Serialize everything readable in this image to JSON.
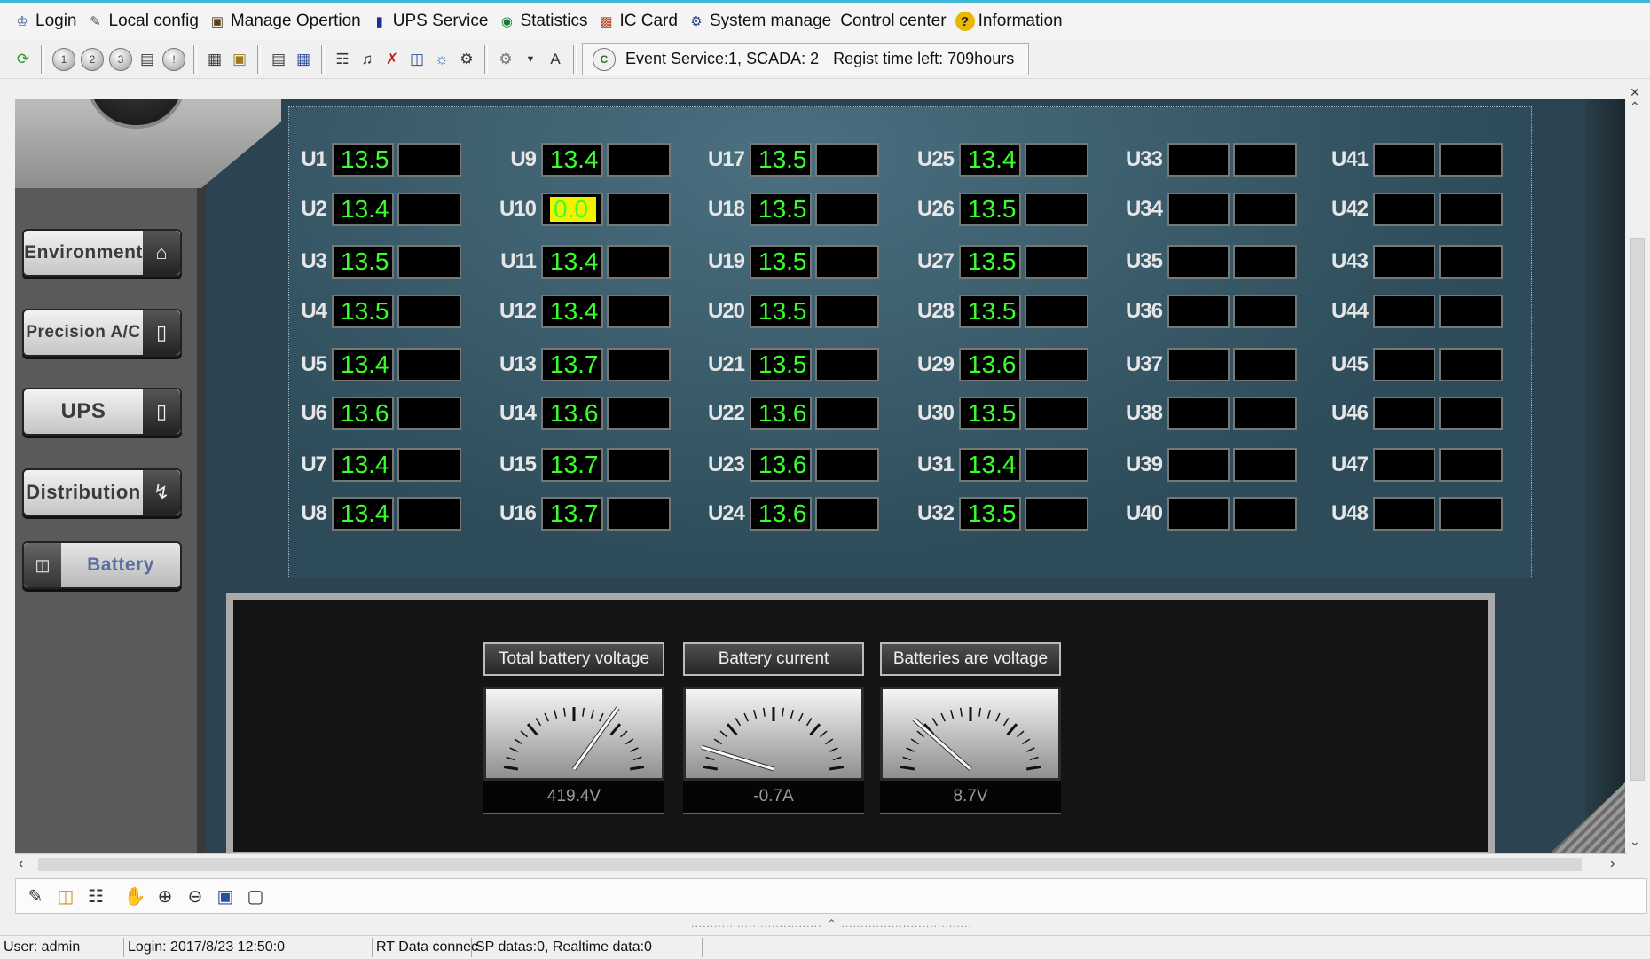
{
  "menu": [
    {
      "label": "Login",
      "icon": "login-icon"
    },
    {
      "label": "Local config",
      "icon": "local-config-icon"
    },
    {
      "label": "Manage Opertion",
      "icon": "manage-operation-icon"
    },
    {
      "label": "UPS Service",
      "icon": "ups-service-icon"
    },
    {
      "label": "Statistics",
      "icon": "statistics-icon"
    },
    {
      "label": "IC Card",
      "icon": "ic-card-icon"
    },
    {
      "label": "System manage",
      "icon": "system-manage-icon"
    },
    {
      "label": "Control center",
      "icon": ""
    },
    {
      "label": "Information",
      "icon": "information-icon"
    }
  ],
  "toolbar": {
    "round_buttons": [
      "1",
      "2",
      "3"
    ],
    "font_label": "A",
    "event_service": "Event Service:1, SCADA: 2",
    "regist_time": "Regist time left: 709hours"
  },
  "sidebar": {
    "items": [
      {
        "label": "Environment",
        "icon": "home-icon"
      },
      {
        "label": "Precision A/C",
        "icon": "ac-unit-icon"
      },
      {
        "label": "UPS",
        "icon": "ups-icon"
      },
      {
        "label": "Distribution",
        "icon": "lightning-icon"
      },
      {
        "label": "Battery",
        "icon": "battery-icon"
      }
    ],
    "active": "Battery"
  },
  "cells": [
    [
      "U1",
      "13.5"
    ],
    [
      "U2",
      "13.4"
    ],
    [
      "U3",
      "13.5"
    ],
    [
      "U4",
      "13.5"
    ],
    [
      "U5",
      "13.4"
    ],
    [
      "U6",
      "13.6"
    ],
    [
      "U7",
      "13.4"
    ],
    [
      "U8",
      "13.4"
    ],
    [
      "U9",
      "13.4"
    ],
    [
      "U10",
      "0.0"
    ],
    [
      "U11",
      "13.4"
    ],
    [
      "U12",
      "13.4"
    ],
    [
      "U13",
      "13.7"
    ],
    [
      "U14",
      "13.6"
    ],
    [
      "U15",
      "13.7"
    ],
    [
      "U16",
      "13.7"
    ],
    [
      "U17",
      "13.5"
    ],
    [
      "U18",
      "13.5"
    ],
    [
      "U19",
      "13.5"
    ],
    [
      "U20",
      "13.5"
    ],
    [
      "U21",
      "13.5"
    ],
    [
      "U22",
      "13.6"
    ],
    [
      "U23",
      "13.6"
    ],
    [
      "U24",
      "13.6"
    ],
    [
      "U25",
      "13.4"
    ],
    [
      "U26",
      "13.5"
    ],
    [
      "U27",
      "13.5"
    ],
    [
      "U28",
      "13.5"
    ],
    [
      "U29",
      "13.6"
    ],
    [
      "U30",
      "13.5"
    ],
    [
      "U31",
      "13.4"
    ],
    [
      "U32",
      "13.5"
    ],
    [
      "U33",
      ""
    ],
    [
      "U34",
      ""
    ],
    [
      "U35",
      ""
    ],
    [
      "U36",
      ""
    ],
    [
      "U37",
      ""
    ],
    [
      "U38",
      ""
    ],
    [
      "U39",
      ""
    ],
    [
      "U40",
      ""
    ],
    [
      "U41",
      ""
    ],
    [
      "U42",
      ""
    ],
    [
      "U43",
      ""
    ],
    [
      "U44",
      ""
    ],
    [
      "U45",
      ""
    ],
    [
      "U46",
      ""
    ],
    [
      "U47",
      ""
    ],
    [
      "U48",
      ""
    ]
  ],
  "highlight_cell": "U10",
  "meters": [
    {
      "title": "Total battery voltage",
      "reading": "419.4V",
      "needle_fraction": 0.72
    },
    {
      "title": "Battery current",
      "reading": "-0.7A",
      "needle_fraction": 0.05
    },
    {
      "title": "Batteries are voltage",
      "reading": "8.7V",
      "needle_fraction": 0.2
    }
  ],
  "status": {
    "user": "User:  admin",
    "login": "Login:  2017/8/23 12:50:0",
    "rt": "RT Data connec",
    "sp": "SP datas:0, Realtime data:0"
  },
  "colors": {
    "value_green": "#3bff2c",
    "highlight_yellow": "#f2f200",
    "panel_bg": "#2c4452"
  }
}
